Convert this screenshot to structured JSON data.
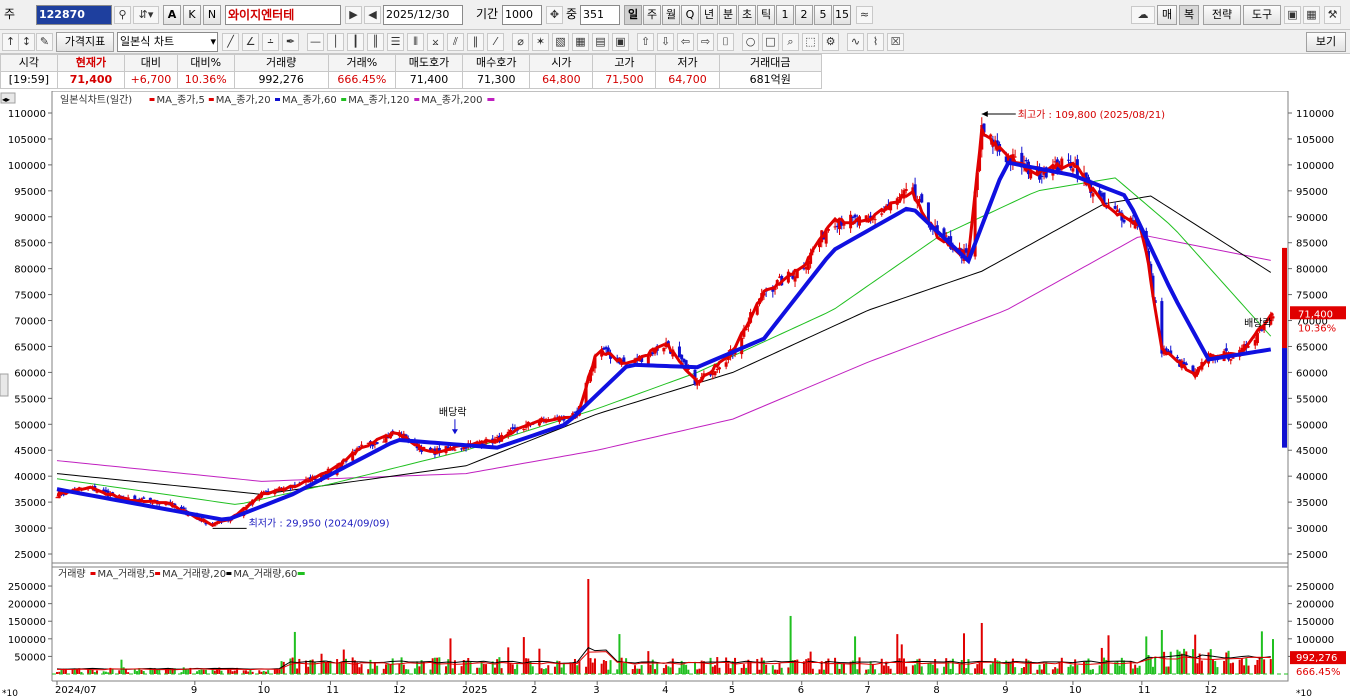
{
  "toolbar1": {
    "type_label": "주",
    "code": "122870",
    "stock_name": "와이지엔터테",
    "date": "2025/12/30",
    "period_label": "기간",
    "period_value": "1000",
    "count_label": "중",
    "count_value": "351",
    "intervals": [
      "일",
      "주",
      "월",
      "Q",
      "년",
      "분",
      "초",
      "틱",
      "1",
      "2",
      "5",
      "15"
    ],
    "right_buttons": [
      "매",
      "복",
      "전략",
      "도구"
    ],
    "btn_a": "A",
    "btn_k": "K",
    "btn_n": "N"
  },
  "toolbar2": {
    "indicator_label": "가격지표",
    "chart_type": "일본식 차트",
    "view_label": "보기"
  },
  "quote": {
    "headers": [
      "시각",
      "현재가",
      "대비",
      "대비%",
      "거래량",
      "거래%",
      "매도호가",
      "매수호가",
      "시가",
      "고가",
      "저가",
      "거래대금"
    ],
    "values": [
      "[19:59]",
      "71,400",
      "+6,700",
      "10.36%",
      "992,276",
      "666.45%",
      "71,400",
      "71,300",
      "64,800",
      "71,500",
      "64,700",
      "681억원"
    ]
  },
  "price_legend": [
    {
      "text": "일본식차트(일간)",
      "color": "#333333"
    },
    {
      "text": "MA_종가,5",
      "color": "#e00000"
    },
    {
      "text": "MA_종가,20",
      "color": "#e00000"
    },
    {
      "text": "MA_종가,60",
      "color": "#1010d0"
    },
    {
      "text": "MA_종가,120",
      "color": "#20c020"
    },
    {
      "text": "MA_종가,200",
      "color": "#c020c0"
    }
  ],
  "volume_legend": [
    {
      "text": "거래량",
      "color": "#e00000"
    },
    {
      "text": "MA_거래량,5",
      "color": "#e00000"
    },
    {
      "text": "MA_거래량,20",
      "color": "#000000"
    },
    {
      "text": "MA_거래량,60",
      "color": "#20c020"
    }
  ],
  "annotations": {
    "high": "최고가 : 109,800 (2025/08/21)",
    "low": "최저가 : 29,950 (2024/09/09)",
    "dividend": "배당락",
    "price_tag": "71,400",
    "pct_tag": "10.36%",
    "vol_tag": "992,276",
    "volpct_tag": "666.45%",
    "vol_unit_right": "*10",
    "vol_unit_left": "*10"
  },
  "chart_data": {
    "type": "candlestick",
    "price_axis": {
      "range": [
        25000,
        110000
      ],
      "ticks": [
        110000,
        105000,
        100000,
        95000,
        90000,
        85000,
        80000,
        75000,
        70000,
        65000,
        60000,
        55000,
        50000,
        45000,
        40000,
        35000,
        30000,
        25000
      ]
    },
    "volume_axis": {
      "range": [
        0,
        270000
      ],
      "ticks": [
        250000,
        200000,
        150000,
        100000,
        50000
      ]
    },
    "x_labels": [
      "2024/07",
      "9",
      "10",
      "11",
      "12",
      "2025",
      "2",
      "3",
      "4",
      "5",
      "6",
      "7",
      "8",
      "9",
      "10",
      "11",
      "12"
    ],
    "close_path": [
      [
        "2024-07-01",
        36500
      ],
      [
        "2024-07-15",
        37800
      ],
      [
        "2024-08-01",
        35500
      ],
      [
        "2024-08-20",
        34800
      ],
      [
        "2024-09-09",
        30500
      ],
      [
        "2024-09-20",
        32500
      ],
      [
        "2024-10-01",
        36500
      ],
      [
        "2024-10-15",
        38000
      ],
      [
        "2024-11-01",
        41000
      ],
      [
        "2024-11-15",
        45500
      ],
      [
        "2024-12-01",
        48500
      ],
      [
        "2024-12-15",
        44500
      ],
      [
        "2025-01-02",
        46000
      ],
      [
        "2025-01-15",
        47000
      ],
      [
        "2025-02-01",
        50500
      ],
      [
        "2025-02-20",
        51500
      ],
      [
        "2025-03-01",
        64500
      ],
      [
        "2025-03-15",
        61500
      ],
      [
        "2025-04-01",
        65500
      ],
      [
        "2025-04-15",
        58000
      ],
      [
        "2025-05-01",
        64000
      ],
      [
        "2025-05-15",
        75500
      ],
      [
        "2025-06-01",
        80000
      ],
      [
        "2025-06-15",
        89500
      ],
      [
        "2025-07-01",
        89000
      ],
      [
        "2025-07-20",
        95000
      ],
      [
        "2025-08-01",
        86500
      ],
      [
        "2025-08-15",
        82000
      ],
      [
        "2025-08-21",
        106500
      ],
      [
        "2025-09-01",
        101500
      ],
      [
        "2025-09-15",
        98500
      ],
      [
        "2025-10-01",
        100500
      ],
      [
        "2025-10-15",
        92000
      ],
      [
        "2025-11-01",
        88500
      ],
      [
        "2025-11-10",
        64500
      ],
      [
        "2025-11-25",
        59500
      ],
      [
        "2025-12-01",
        63000
      ],
      [
        "2025-12-15",
        63500
      ],
      [
        "2025-12-30",
        71400
      ]
    ],
    "ma60": [
      [
        "2024-07-01",
        37500
      ],
      [
        "2024-09-15",
        31500
      ],
      [
        "2024-10-15",
        36500
      ],
      [
        "2024-12-01",
        47000
      ],
      [
        "2025-01-15",
        45500
      ],
      [
        "2025-02-15",
        50000
      ],
      [
        "2025-03-15",
        61500
      ],
      [
        "2025-04-15",
        61000
      ],
      [
        "2025-05-15",
        66500
      ],
      [
        "2025-06-15",
        83500
      ],
      [
        "2025-07-20",
        92000
      ],
      [
        "2025-08-15",
        81500
      ],
      [
        "2025-09-01",
        100500
      ],
      [
        "2025-10-01",
        98000
      ],
      [
        "2025-10-25",
        94000
      ],
      [
        "2025-11-15",
        75000
      ],
      [
        "2025-12-01",
        62500
      ],
      [
        "2025-12-30",
        64500
      ]
    ],
    "ma120": [
      [
        "2024-07-01",
        39500
      ],
      [
        "2024-09-20",
        34500
      ],
      [
        "2024-11-01",
        38500
      ],
      [
        "2025-01-01",
        45000
      ],
      [
        "2025-03-01",
        53000
      ],
      [
        "2025-04-15",
        60000
      ],
      [
        "2025-06-15",
        72000
      ],
      [
        "2025-08-01",
        86000
      ],
      [
        "2025-09-15",
        95000
      ],
      [
        "2025-10-20",
        97500
      ],
      [
        "2025-11-15",
        88000
      ],
      [
        "2025-12-30",
        66500
      ]
    ],
    "ma200": [
      [
        "2024-07-01",
        43000
      ],
      [
        "2024-10-01",
        39000
      ],
      [
        "2025-01-01",
        40500
      ],
      [
        "2025-03-01",
        45000
      ],
      [
        "2025-05-01",
        51000
      ],
      [
        "2025-07-01",
        62000
      ],
      [
        "2025-09-01",
        72000
      ],
      [
        "2025-11-01",
        86500
      ],
      [
        "2025-12-30",
        81500
      ]
    ],
    "ma_black": [
      [
        "2024-07-01",
        40500
      ],
      [
        "2024-10-01",
        36500
      ],
      [
        "2025-01-01",
        42000
      ],
      [
        "2025-03-01",
        52000
      ],
      [
        "2025-05-01",
        60000
      ],
      [
        "2025-07-01",
        72000
      ],
      [
        "2025-08-21",
        79500
      ],
      [
        "2025-10-15",
        92500
      ],
      [
        "2025-11-05",
        94000
      ],
      [
        "2025-12-30",
        79000
      ]
    ],
    "volume_spikes": [
      [
        "2025-02-25",
        270000
      ],
      [
        "2025-05-27",
        165000
      ],
      [
        "2025-08-21",
        145000
      ],
      [
        "2025-10-17",
        110000
      ],
      [
        "2025-11-10",
        125000
      ],
      [
        "2025-12-30",
        99227
      ]
    ],
    "last": {
      "close": 71400,
      "change": 6700,
      "change_pct": 10.36,
      "volume": 992276
    }
  }
}
